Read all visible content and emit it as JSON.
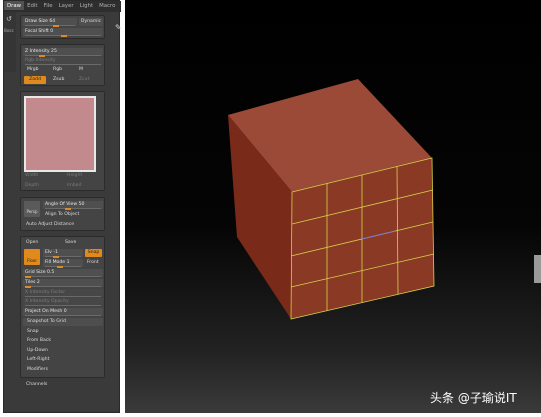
{
  "menu": [
    "Draw",
    "Edit",
    "File",
    "Layer",
    "Light",
    "Macro"
  ],
  "side_strip": {
    "label": "Bosc"
  },
  "draw_section": {
    "draw_size": "Draw Size 64",
    "dynamic": "Dynamic",
    "focal_shift": "Focal Shift 0"
  },
  "intensity_section": {
    "z_intensity": "Z Intensity 25",
    "rgb_intensity": "Rgb Intensity",
    "mrgb": "Mrgb",
    "rgb": "Rgb",
    "m": "M",
    "zadd": "Zadd",
    "zsub": "Zsub",
    "zcut": "Zcut"
  },
  "texture_section": {
    "width": "Width",
    "height": "Height",
    "depth": "Depth",
    "imbed": "Imbed"
  },
  "view_section": {
    "persp": "Persp",
    "angle_of_view": "Angle Of View 50",
    "align_to_object": "Align To Object",
    "auto_adjust_distance": "Auto Adjust Distance"
  },
  "grid_section": {
    "open": "Open",
    "save": "Save",
    "elv": "Elv -1",
    "snap": "Snap",
    "floor": "Floor",
    "fill_mode": "Fill Mode 1",
    "front": "Front",
    "grid_size": "Grid Size 0.5",
    "tiles": "Tiles 2",
    "x_intensity_factor": "X Intensity Factor",
    "x_intensity_opacity": "X Intensity Opacity",
    "project_on_mesh": "Project On Mesh 0",
    "snapshot_to_grid": "Snapshot To Grid",
    "snap_label": "Snap",
    "from_back": "From Back",
    "up_down": "Up-Down",
    "left_right": "Left-Right",
    "modifiers": "Modifiers"
  },
  "channels": "Channels",
  "watermark": "头条 @子瑜说IT",
  "colors": {
    "accent": "#e08a1e",
    "cube_face": "#8a3a24",
    "grid_line": "#d8d04a",
    "panel_bg": "#3a3a3a"
  }
}
